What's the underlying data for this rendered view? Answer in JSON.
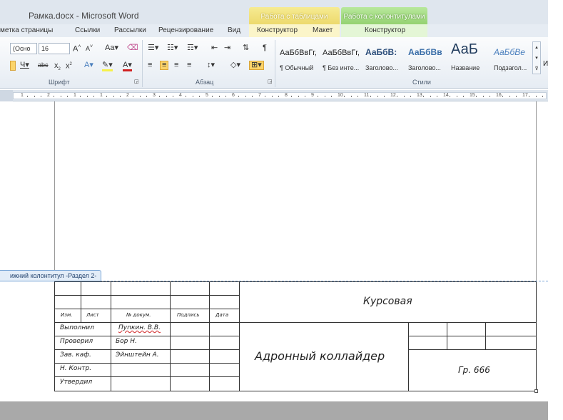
{
  "window": {
    "title": "Рамка.docx - Microsoft Word"
  },
  "context_tabs": {
    "tables": "Работа с таблицами",
    "headers": "Работа с колонтитулами"
  },
  "tabs": [
    {
      "label": "метка страницы"
    },
    {
      "label": "Ссылки"
    },
    {
      "label": "Рассылки"
    },
    {
      "label": "Рецензирование"
    },
    {
      "label": "Вид"
    },
    {
      "label": "Конструктор"
    },
    {
      "label": "Макет"
    },
    {
      "label": "Конструктор"
    }
  ],
  "ribbon": {
    "font_name": "(Осно",
    "font_size": "16",
    "groups": {
      "font": "Шрифт",
      "paragraph": "Абзац",
      "styles": "Стили"
    },
    "styles": [
      {
        "sample": "АаБбВвГг,",
        "name": "¶ Обычный",
        "color": "#222222"
      },
      {
        "sample": "АаБбВвГг,",
        "name": "¶ Без инте...",
        "color": "#222222"
      },
      {
        "sample": "АаБбВ:",
        "name": "Заголово...",
        "color": "#2b4d7a"
      },
      {
        "sample": "АаБбВв",
        "name": "Заголово...",
        "color": "#3a6ea8"
      },
      {
        "sample": "АаБ",
        "name": "Название",
        "color": "#1f3a5c"
      },
      {
        "sample": "АаБбВе",
        "name": "Подзагол...",
        "color": "#4a7fbd"
      }
    ],
    "overflow_label": "И"
  },
  "ruler": {
    "numbers": [
      "1",
      "2",
      "1",
      "1",
      "2",
      "3",
      "4",
      "5",
      "6",
      "7",
      "8",
      "9",
      "10",
      "11",
      "12",
      "13",
      "14",
      "15",
      "16",
      "17"
    ]
  },
  "footer": {
    "tag": "ижний колонтитул -Раздел 2-"
  },
  "stamp": {
    "headers": {
      "izm": "Изм.",
      "list": "Лист",
      "doc_no": "№ докум.",
      "signature": "Подпись",
      "date": "Дата"
    },
    "rows": [
      {
        "label": "Выполнил",
        "name": "Пупкин. В.В."
      },
      {
        "label": "Проверил",
        "name": "Бор Н."
      },
      {
        "label": "Зав. каф.",
        "name": "Эйнштейн А."
      },
      {
        "label": "Н. Контр.",
        "name": ""
      },
      {
        "label": "Утвердил",
        "name": ""
      }
    ],
    "course": "Курсовая",
    "project": "Адронный коллайдер",
    "group": "Гр. 666"
  }
}
